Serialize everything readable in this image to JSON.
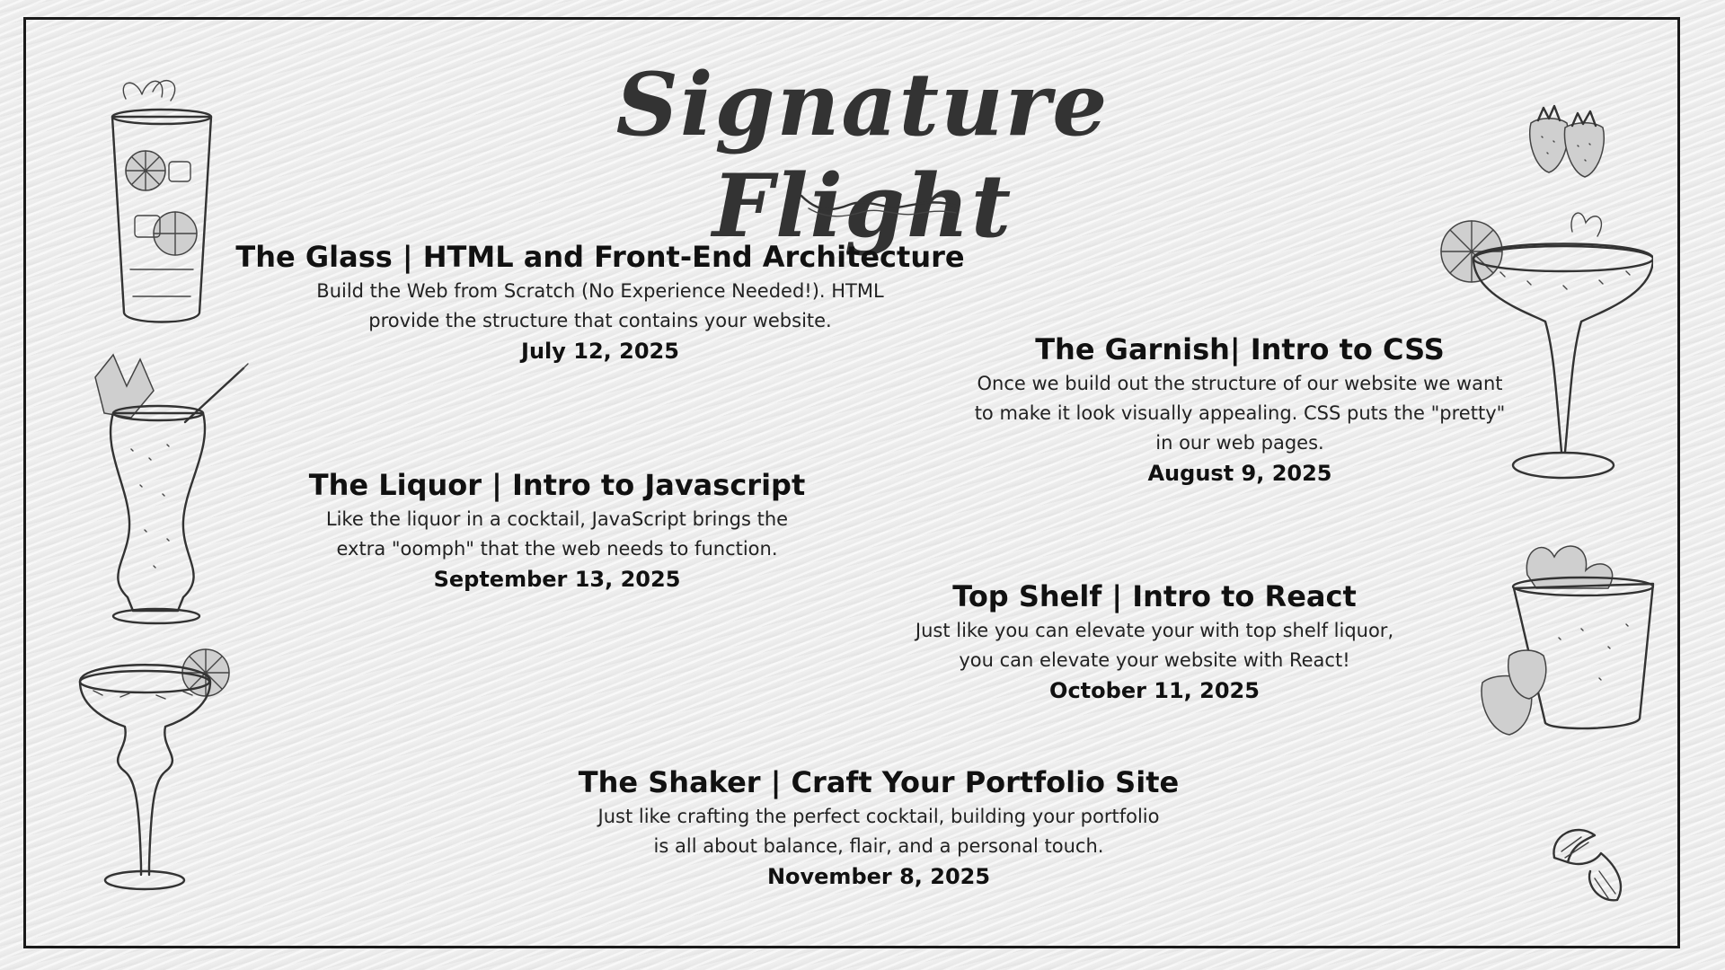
{
  "header": {
    "title": "Signature Flight"
  },
  "sections": [
    {
      "heading": "The Glass | HTML and Front-End Architecture",
      "line1": "Build the Web from Scratch (No Experience Needed!). HTML",
      "line2": "provide the structure that contains your website.",
      "date": "July 12, 2025"
    },
    {
      "heading": "The Garnish| Intro to CSS",
      "line1": "Once we build out the structure of our website we want",
      "line2": "to make it look visually appealing. CSS puts the \"pretty\"",
      "line3": "in our web pages.",
      "date": "August 9, 2025"
    },
    {
      "heading": "The Liquor | Intro to Javascript",
      "line1": "Like the liquor in a cocktail, JavaScript brings the",
      "line2": "extra \"oomph\" that the web needs to function.",
      "date": "September 13, 2025"
    },
    {
      "heading": "Top Shelf | Intro to React",
      "line1": "Just like you can elevate your with top shelf liquor,",
      "line2": "you can elevate your website with React!",
      "date": "October 11, 2025"
    },
    {
      "heading": "The Shaker | Craft Your Portfolio Site",
      "line1": "Just like crafting the perfect cocktail, building your portfolio",
      "line2": "is all about balance, flair, and a personal touch.",
      "date": "November 8, 2025"
    }
  ],
  "illustrations": [
    "highball-glass-icon",
    "hurricane-glass-icon",
    "margarita-glass-icon",
    "strawberries-icon",
    "margarita-with-orange-icon",
    "berry-cup-icon",
    "orange-peel-icon"
  ],
  "colors": {
    "background": "#ededed",
    "frame": "#1a1a1a",
    "text": "#111111",
    "title": "#333333"
  }
}
